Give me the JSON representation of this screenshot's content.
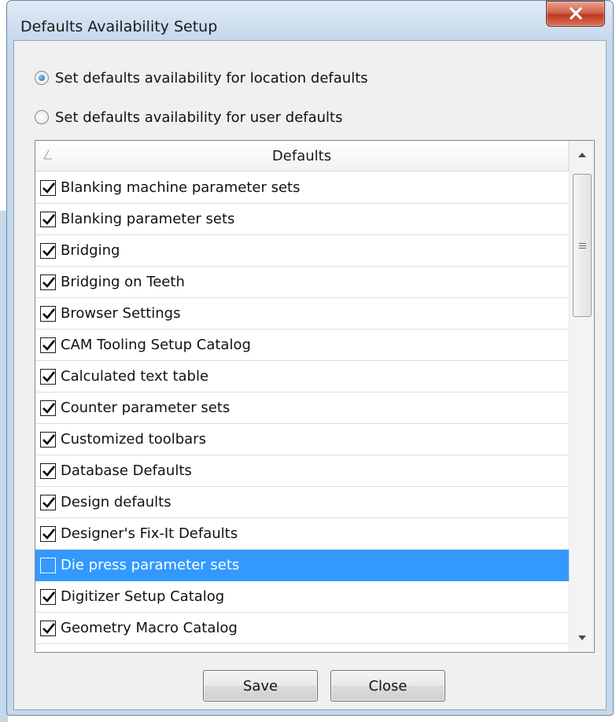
{
  "window": {
    "title": "Defaults Availability Setup",
    "close_icon": "close-x-icon"
  },
  "options": {
    "location_label": "Set defaults availability for location defaults",
    "user_label": "Set defaults availability for user defaults",
    "selected": "location"
  },
  "list": {
    "header": "Defaults",
    "items": [
      {
        "label": "Blanking machine parameter sets",
        "checked": true,
        "selected": false
      },
      {
        "label": "Blanking parameter sets",
        "checked": true,
        "selected": false
      },
      {
        "label": "Bridging",
        "checked": true,
        "selected": false
      },
      {
        "label": "Bridging on Teeth",
        "checked": true,
        "selected": false
      },
      {
        "label": "Browser Settings",
        "checked": true,
        "selected": false
      },
      {
        "label": "CAM Tooling Setup Catalog",
        "checked": true,
        "selected": false
      },
      {
        "label": "Calculated text table",
        "checked": true,
        "selected": false
      },
      {
        "label": "Counter parameter sets",
        "checked": true,
        "selected": false
      },
      {
        "label": "Customized toolbars",
        "checked": true,
        "selected": false
      },
      {
        "label": "Database Defaults",
        "checked": true,
        "selected": false
      },
      {
        "label": "Design defaults",
        "checked": true,
        "selected": false
      },
      {
        "label": "Designer's Fix-It Defaults",
        "checked": true,
        "selected": false
      },
      {
        "label": "Die press parameter sets",
        "checked": false,
        "selected": true
      },
      {
        "label": "Digitizer Setup Catalog",
        "checked": true,
        "selected": false
      },
      {
        "label": "Geometry Macro Catalog",
        "checked": true,
        "selected": false
      }
    ]
  },
  "buttons": {
    "save_label": "Save",
    "close_label": "Close"
  },
  "colors": {
    "selection": "#3399ff",
    "window_frame": "#c5d8ec",
    "close_button": "#c0391f"
  }
}
